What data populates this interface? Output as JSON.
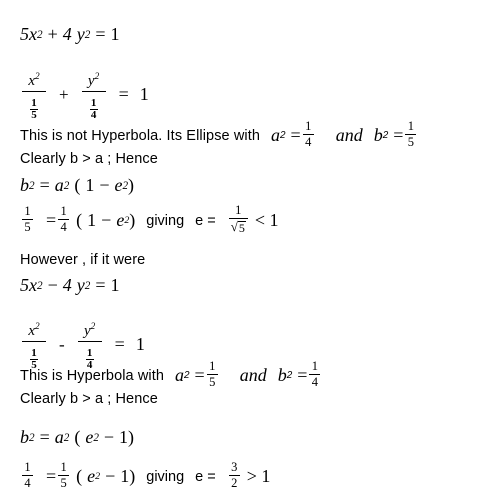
{
  "document": {
    "background_color": "#ffffff",
    "text_color": "#000000",
    "title": "Conic section worked solution: ellipse vs hyperbola"
  },
  "symbols": {
    "x": "x",
    "y": "y",
    "a": "a",
    "b": "b",
    "e": "e",
    "two": "2",
    "one": "1",
    "plus": "+",
    "minus": "−",
    "equals": "=",
    "lparen": "(",
    "rparen": ")",
    "less_than": "<",
    "greater_than": ">",
    "sqrt_sign": "√",
    "and": "and",
    "giving": "giving"
  },
  "section_ellipse": {
    "equation_general": {
      "coefficient_x": "5",
      "coefficient_y": "4",
      "operator": "+",
      "rhs": "1"
    },
    "equation_standard": {
      "num_left": "x",
      "num_right": "y",
      "den_left_num": "1",
      "den_left_den": "5",
      "den_right_num": "1",
      "den_right_den": "4",
      "operator": "-",
      "rhs": "1"
    },
    "statement": "This is not Hyperbola. Its Ellipse with",
    "a_squared_num": "1",
    "a_squared_den": "4",
    "b_squared_num": "1",
    "b_squared_den": "5",
    "clearly": "Clearly  b > a ;  Hence",
    "relation": {
      "lhs": "b",
      "rhs_coeff": "a",
      "inner_first": "1",
      "inner_operator": "−",
      "inner_second": "e"
    },
    "substitution": {
      "lhs_num": "1",
      "lhs_den": "5",
      "rhs_num": "1",
      "rhs_den": "4",
      "inner_first": "1",
      "inner_operator": "−",
      "inner_second": "e",
      "giving": "giving",
      "e_label": "e =",
      "e_value_num": "1",
      "e_value_den_sqrt": "5",
      "comparison": "< 1"
    }
  },
  "section_hyperbola": {
    "intro": "However , if it were",
    "equation_general": {
      "coefficient_x": "5",
      "coefficient_y": "4",
      "operator": "−",
      "rhs": "1"
    },
    "equation_standard": {
      "num_left": "x",
      "num_right": "y",
      "den_left_num": "1",
      "den_left_den": "5",
      "den_right_num": "1",
      "den_right_den": "4",
      "operator": "-",
      "rhs": "1"
    },
    "statement": "This is  Hyperbola   with",
    "a_squared_num": "1",
    "a_squared_den": "5",
    "b_squared_num": "1",
    "b_squared_den": "4",
    "clearly": "Clearly  b > a ;  Hence",
    "relation": {
      "lhs": "b",
      "rhs_coeff": "a",
      "inner_first": "e",
      "inner_operator": "−",
      "inner_second": "1"
    },
    "substitution": {
      "lhs_num": "1",
      "lhs_den": "4",
      "rhs_num": "1",
      "rhs_den": "5",
      "inner_first": "e",
      "inner_operator": "−",
      "inner_second": "1",
      "giving": "giving",
      "e_label": "e =",
      "e_value_num": "3",
      "e_value_den": "2",
      "comparison": "> 1"
    }
  }
}
